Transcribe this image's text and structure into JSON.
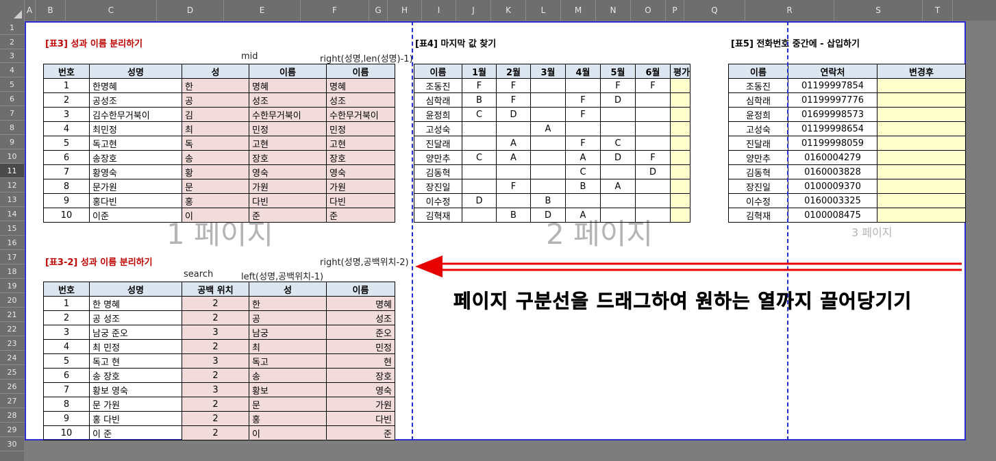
{
  "columns": [
    "A",
    "B",
    "C",
    "D",
    "E",
    "F",
    "G",
    "H",
    "I",
    "J",
    "K",
    "L",
    "M",
    "N",
    "O",
    "P",
    "Q",
    "R",
    "S",
    "T"
  ],
  "rows": [
    "1",
    "2",
    "3",
    "4",
    "5",
    "6",
    "7",
    "8",
    "9",
    "10",
    "11",
    "12",
    "13",
    "14",
    "15",
    "16",
    "17",
    "18",
    "19",
    "20",
    "21",
    "22",
    "23",
    "24",
    "25",
    "26",
    "27",
    "28",
    "29",
    "30"
  ],
  "selected_row": "11",
  "table3": {
    "title": "[표3] 성과 이름 분리하기",
    "formula_mid": "mid",
    "formula_right": "right(성명,len(성명)-1)",
    "headers": [
      "번호",
      "성명",
      "성",
      "이름",
      "이름"
    ],
    "rows": [
      [
        "1",
        "한명혜",
        "한",
        "명혜",
        "명혜"
      ],
      [
        "2",
        "공성조",
        "공",
        "성조",
        "성조"
      ],
      [
        "3",
        "김수한무거북이",
        "김",
        "수한무거북이",
        "수한무거북이"
      ],
      [
        "4",
        "최민정",
        "최",
        "민정",
        "민정"
      ],
      [
        "5",
        "독고현",
        "독",
        "고현",
        "고현"
      ],
      [
        "6",
        "송장호",
        "송",
        "장호",
        "장호"
      ],
      [
        "7",
        "황영숙",
        "황",
        "영숙",
        "영숙"
      ],
      [
        "8",
        "문가원",
        "문",
        "가원",
        "가원"
      ],
      [
        "9",
        "홍다빈",
        "홍",
        "다빈",
        "다빈"
      ],
      [
        "10",
        "이준",
        "이",
        "준",
        "준"
      ]
    ]
  },
  "table3_2": {
    "title": "[표3-2] 성과 이름 분리하기",
    "formula_right": "right(성명,공백위치-2)",
    "formula_search": "search",
    "formula_left": "left(성명,공백위치-1)",
    "headers": [
      "번호",
      "성명",
      "공백 위치",
      "성",
      "이름"
    ],
    "rows": [
      [
        "1",
        "한 명혜",
        "2",
        "한",
        "명혜"
      ],
      [
        "2",
        "공 성조",
        "2",
        "공",
        "성조"
      ],
      [
        "3",
        "남궁 준오",
        "3",
        "남궁",
        "준오"
      ],
      [
        "4",
        "최 민정",
        "2",
        "최",
        "민정"
      ],
      [
        "5",
        "독고 현",
        "3",
        "독고",
        "현"
      ],
      [
        "6",
        "송 장호",
        "2",
        "송",
        "장호"
      ],
      [
        "7",
        "황보 영숙",
        "3",
        "황보",
        "영숙"
      ],
      [
        "8",
        "문 가원",
        "2",
        "문",
        "가원"
      ],
      [
        "9",
        "홍 다빈",
        "2",
        "홍",
        "다빈"
      ],
      [
        "10",
        "이 준",
        "2",
        "이",
        "준"
      ]
    ]
  },
  "table4": {
    "title": "[표4] 마지막 값 찾기",
    "headers": [
      "이름",
      "1월",
      "2월",
      "3월",
      "4월",
      "5월",
      "6월",
      "평가"
    ],
    "rows": [
      [
        "조동진",
        "F",
        "F",
        "",
        "",
        "F",
        "F",
        ""
      ],
      [
        "심학래",
        "B",
        "F",
        "",
        "F",
        "D",
        "",
        ""
      ],
      [
        "윤정희",
        "C",
        "D",
        "",
        "F",
        "",
        "",
        ""
      ],
      [
        "고성숙",
        "",
        "",
        "A",
        "",
        "",
        "",
        ""
      ],
      [
        "진달래",
        "",
        "A",
        "",
        "F",
        "C",
        "",
        ""
      ],
      [
        "양만추",
        "C",
        "A",
        "",
        "A",
        "D",
        "F",
        ""
      ],
      [
        "김동혁",
        "",
        "",
        "",
        "C",
        "",
        "D",
        ""
      ],
      [
        "장진일",
        "",
        "F",
        "",
        "B",
        "A",
        "",
        ""
      ],
      [
        "이수정",
        "D",
        "",
        "B",
        "",
        "",
        "",
        ""
      ],
      [
        "김혁재",
        "",
        "B",
        "D",
        "A",
        "",
        "",
        ""
      ]
    ]
  },
  "table5": {
    "title": "[표5] 전화번호 중간에 - 삽입하기",
    "headers": [
      "이름",
      "연락처",
      "변경후"
    ],
    "rows": [
      [
        "조동진",
        "01199997854",
        ""
      ],
      [
        "심학래",
        "01199997776",
        ""
      ],
      [
        "윤정희",
        "01699998573",
        ""
      ],
      [
        "고성숙",
        "01199998654",
        ""
      ],
      [
        "진달래",
        "01199998059",
        ""
      ],
      [
        "양만추",
        "0160004279",
        ""
      ],
      [
        "김동혁",
        "0160003828",
        ""
      ],
      [
        "장진일",
        "0100009370",
        ""
      ],
      [
        "이수정",
        "0160003325",
        ""
      ],
      [
        "김혁재",
        "0100008475",
        ""
      ]
    ]
  },
  "watermarks": {
    "page1": "1 페이지",
    "page2": "2 페이지",
    "page3": "3 페이지"
  },
  "annotation": "페이지 구분선을 드래그하여 원하는 열까지 끌어당기기",
  "colors": {
    "header_fill": "#dce6f1",
    "pink_fill": "#f2dcdb",
    "yellow_fill": "#ffffcc",
    "title_red": "#c00000",
    "page_break_blue": "#1f2fd0",
    "arrow_red": "#e60000"
  }
}
